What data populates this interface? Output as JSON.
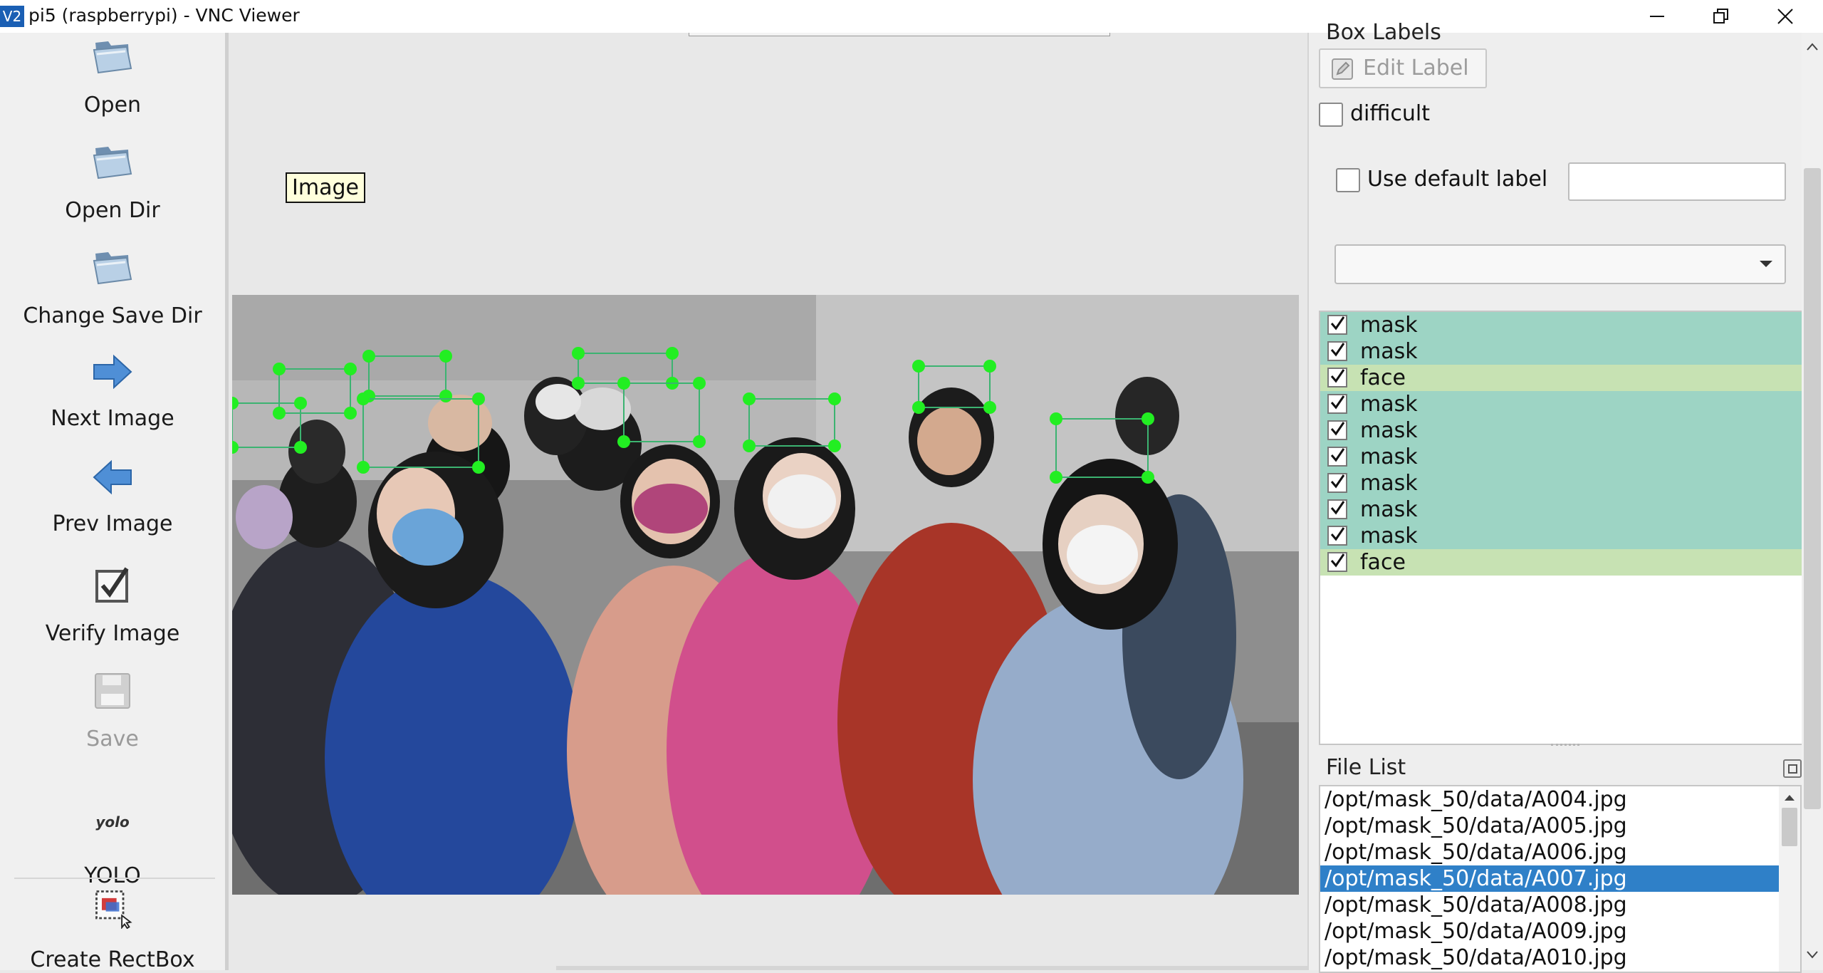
{
  "window": {
    "logo_text": "V2",
    "title": "pi5 (raspberrypi) - VNC Viewer"
  },
  "toolbar": {
    "open": "Open",
    "open_dir": "Open Dir",
    "change_save_dir": "Change Save Dir",
    "next_image": "Next Image",
    "prev_image": "Prev Image",
    "verify_image": "Verify Image",
    "save": "Save",
    "yolo_icon_text": "yolo",
    "yolo": "YOLO",
    "create_rectbox": "Create RectBox"
  },
  "canvas": {
    "tooltip": "Image"
  },
  "box_labels": {
    "title": "Box Labels",
    "edit_label": "Edit Label",
    "difficult": "difficult",
    "use_default_label": "Use default label",
    "default_label_value": "",
    "combo_value": ""
  },
  "labels": [
    {
      "text": "mask",
      "color": "#9dd4c4",
      "checked": true
    },
    {
      "text": "mask",
      "color": "#9dd4c4",
      "checked": true
    },
    {
      "text": "face",
      "color": "#c7e2b3",
      "checked": true
    },
    {
      "text": "mask",
      "color": "#9dd4c4",
      "checked": true
    },
    {
      "text": "mask",
      "color": "#9dd4c4",
      "checked": true
    },
    {
      "text": "mask",
      "color": "#9dd4c4",
      "checked": true
    },
    {
      "text": "mask",
      "color": "#9dd4c4",
      "checked": true
    },
    {
      "text": "mask",
      "color": "#9dd4c4",
      "checked": true
    },
    {
      "text": "mask",
      "color": "#9dd4c4",
      "checked": true
    },
    {
      "text": "face",
      "color": "#c7e2b3",
      "checked": true
    }
  ],
  "file_list": {
    "title": "File List",
    "selected_index": 3,
    "files": [
      "/opt/mask_50/data/A004.jpg",
      "/opt/mask_50/data/A005.jpg",
      "/opt/mask_50/data/A006.jpg",
      "/opt/mask_50/data/A007.jpg",
      "/opt/mask_50/data/A008.jpg",
      "/opt/mask_50/data/A009.jpg",
      "/opt/mask_50/data/A010.jpg"
    ]
  },
  "colors": {
    "handle": "#22ee22",
    "box_stroke": "#3cb371",
    "selection": "#2f80c8"
  }
}
